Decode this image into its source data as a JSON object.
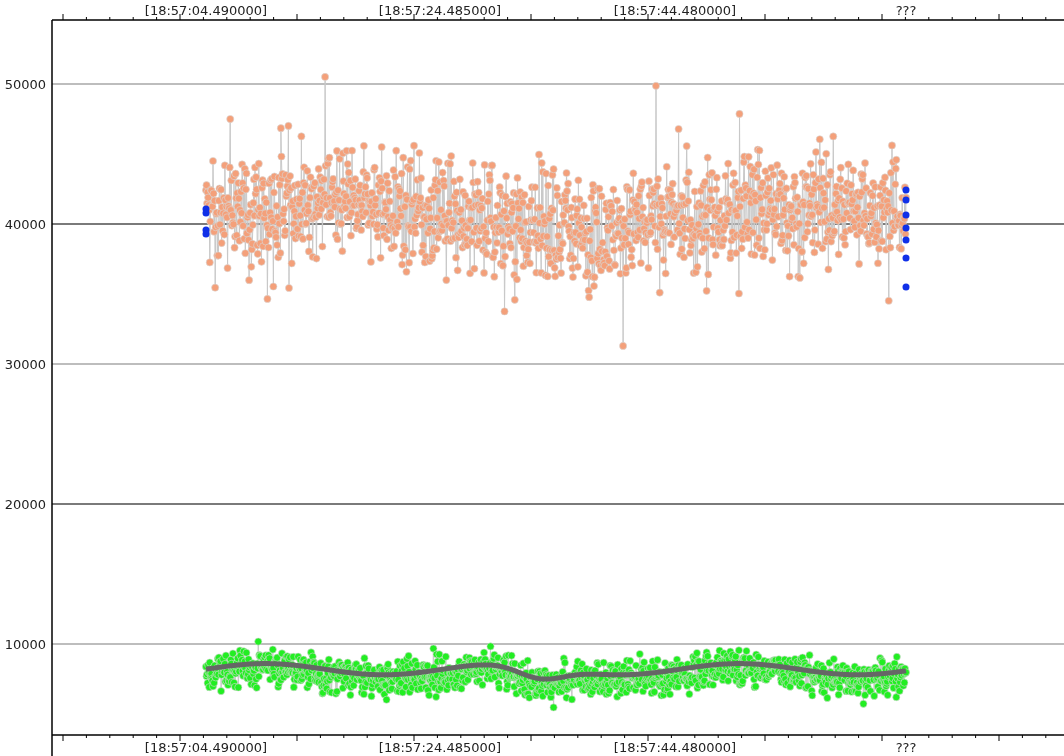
{
  "x_axis_top": {
    "labels": [
      "[18:57:04.490000]",
      "[18:57:24.485000]",
      "[18:57:44.480000]",
      "???"
    ]
  },
  "x_axis_bottom": {
    "labels": [
      "[18:57:04.490000]",
      "[18:57:24.485000]",
      "[18:57:44.480000]",
      "???"
    ]
  },
  "y_axis": {
    "labels": [
      {
        "text": "50000",
        "major": false
      },
      {
        "text": "40000",
        "major": true
      },
      {
        "text": "30000",
        "major": false
      },
      {
        "text": "20000",
        "major": true
      },
      {
        "text": "10000",
        "major": false
      }
    ]
  },
  "series": [
    {
      "kind": "cloud",
      "color": "#f4a07a"
    },
    {
      "kind": "edge",
      "color": "#1030e8"
    },
    {
      "kind": "low",
      "color": "#22ee22"
    },
    {
      "kind": "trend",
      "color": "#666666"
    }
  ]
}
